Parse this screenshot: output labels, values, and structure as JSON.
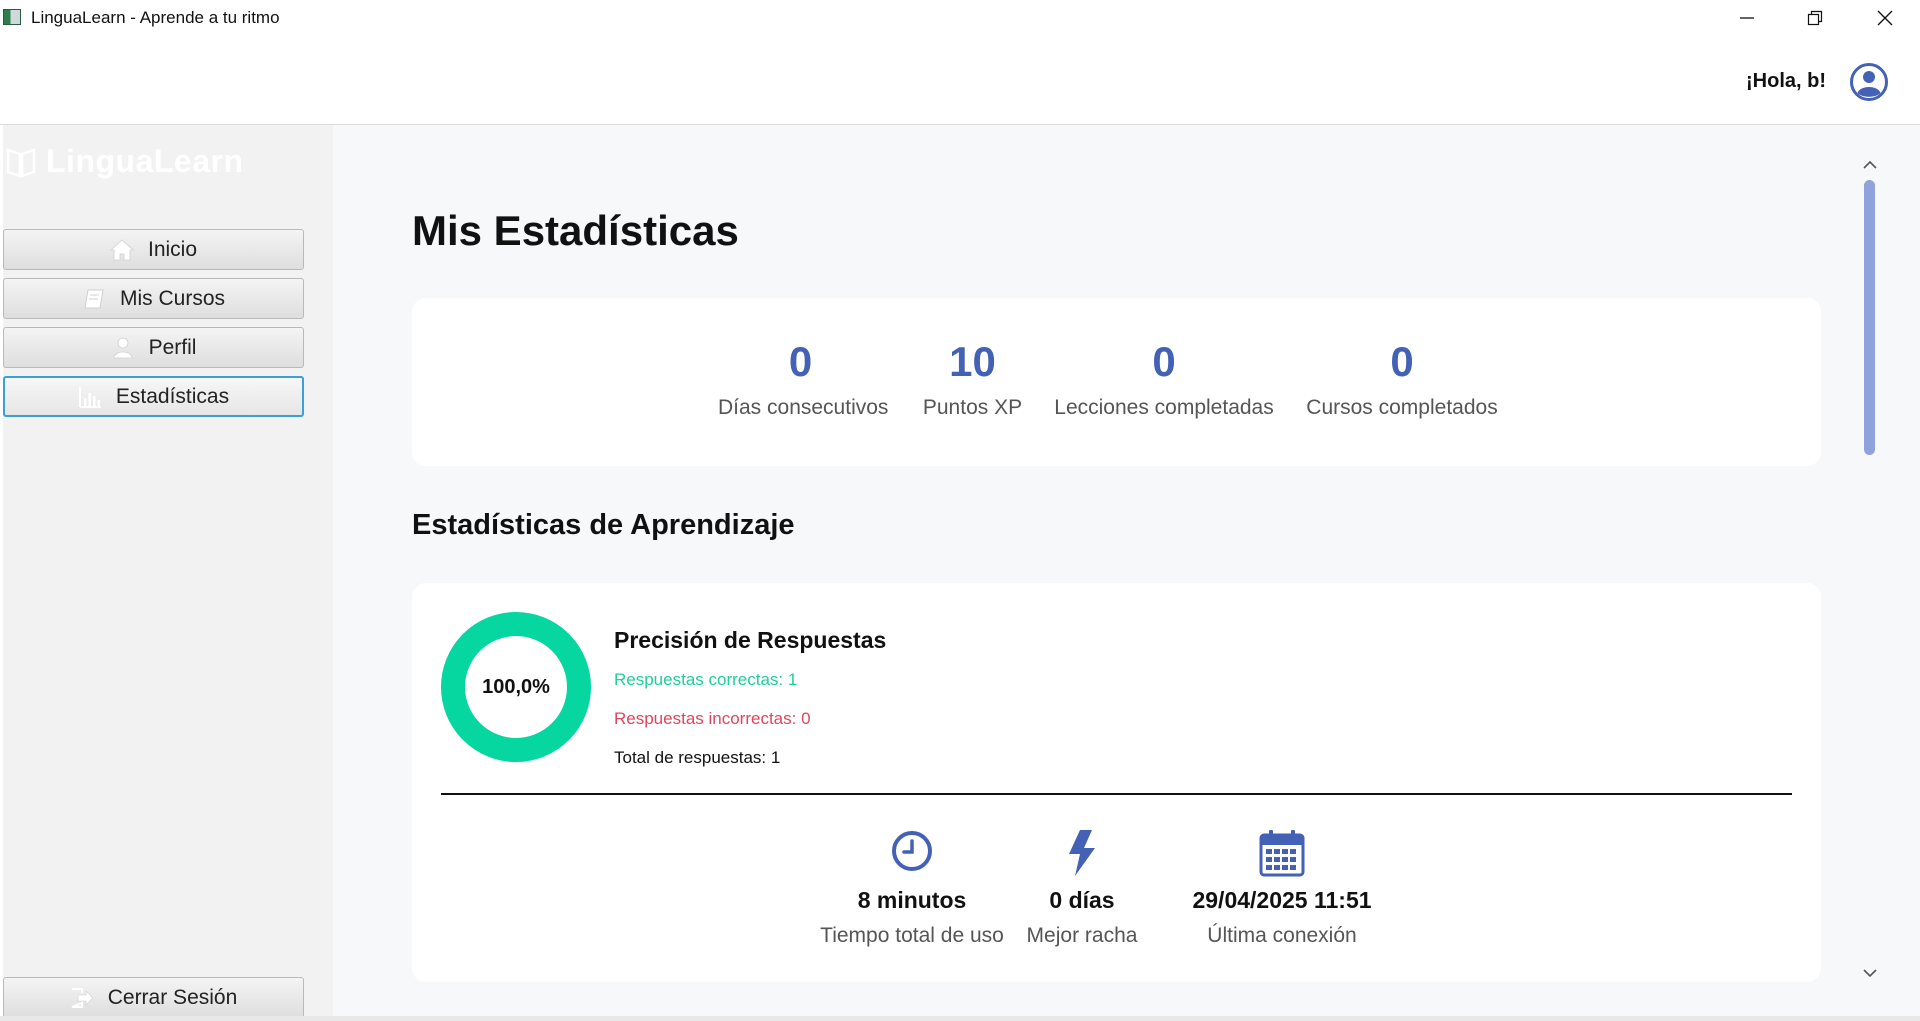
{
  "window": {
    "title": "LinguaLearn - Aprende a tu ritmo"
  },
  "header": {
    "greeting": "¡Hola, b!"
  },
  "sidebar": {
    "brand": "LinguaLearn",
    "items": [
      {
        "label": "Inicio",
        "icon": "home-icon",
        "active": false
      },
      {
        "label": "Mis Cursos",
        "icon": "book-icon",
        "active": false
      },
      {
        "label": "Perfil",
        "icon": "user-icon",
        "active": false
      },
      {
        "label": "Estadísticas",
        "icon": "bar-chart-icon",
        "active": true
      }
    ],
    "logout": {
      "label": "Cerrar Sesión",
      "icon": "logout-icon"
    }
  },
  "main": {
    "title": "Mis Estadísticas",
    "summary": [
      {
        "value": "0",
        "label": "Días consecutivos"
      },
      {
        "value": "10",
        "label": "Puntos XP"
      },
      {
        "value": "0",
        "label": "Lecciones completadas"
      },
      {
        "value": "0",
        "label": "Cursos completados"
      }
    ],
    "section_title": "Estadísticas de Aprendizaje",
    "precision": {
      "title": "Precisión de Respuestas",
      "percent_label": "100,0%",
      "percent_value": 100.0,
      "correct": "Respuestas correctas: 1",
      "incorrect": "Respuestas incorrectas: 0",
      "total": "Total de respuestas: 1"
    },
    "metrics": [
      {
        "icon": "clock-icon",
        "value": "8 minutos",
        "label": "Tiempo total de uso"
      },
      {
        "icon": "lightning-icon",
        "value": "0 días",
        "label": "Mejor racha"
      },
      {
        "icon": "calendar-icon",
        "value": "29/04/2025 11:51",
        "label": "Última conexión"
      }
    ]
  },
  "colors": {
    "accent_blue": "#4361b5",
    "correct_green": "#1fcf9a",
    "incorrect_red": "#e0455f",
    "donut_green": "#06d6a0",
    "active_border": "#3aa0d8",
    "scroll_thumb": "#8fa2dc"
  }
}
